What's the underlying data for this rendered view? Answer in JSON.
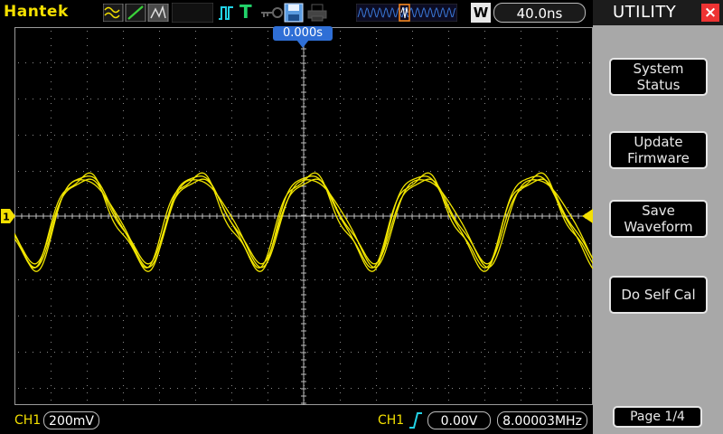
{
  "topbar": {
    "brand": "Hantek",
    "timebase": "40.0ns",
    "mode_letter": "W",
    "icons": [
      "waveform-display-icon",
      "line-icon",
      "persistence-icon",
      "pulse-trigger-icon",
      "trigger-T-icon",
      "key-icon",
      "save-disk-icon",
      "print-icon",
      "memory-position-icon"
    ]
  },
  "screen": {
    "trigger_position": "0.000s",
    "trace_color": "#f2e600",
    "grid_color": "#8a8a8a"
  },
  "bottombar": {
    "ch1_label": "CH1",
    "ch1_scale": "200mV",
    "trig_source": "CH1",
    "trig_level": "0.00V",
    "frequency": "8.00003MHz"
  },
  "panel": {
    "title": "UTILITY",
    "close_icon": "close-icon",
    "buttons": [
      {
        "line1": "System",
        "line2": "Status"
      },
      {
        "line1": "Update",
        "line2": "Firmware"
      },
      {
        "line1": "Save",
        "line2": "Waveform"
      },
      {
        "line1": "Do Self Cal",
        "line2": ""
      }
    ],
    "page": "Page 1/4"
  },
  "colors": {
    "accent_yellow": "#f2e600",
    "panel_gray": "#a8a8a8",
    "trigger_blue": "#2f6fd6",
    "close_red": "#e33333"
  }
}
